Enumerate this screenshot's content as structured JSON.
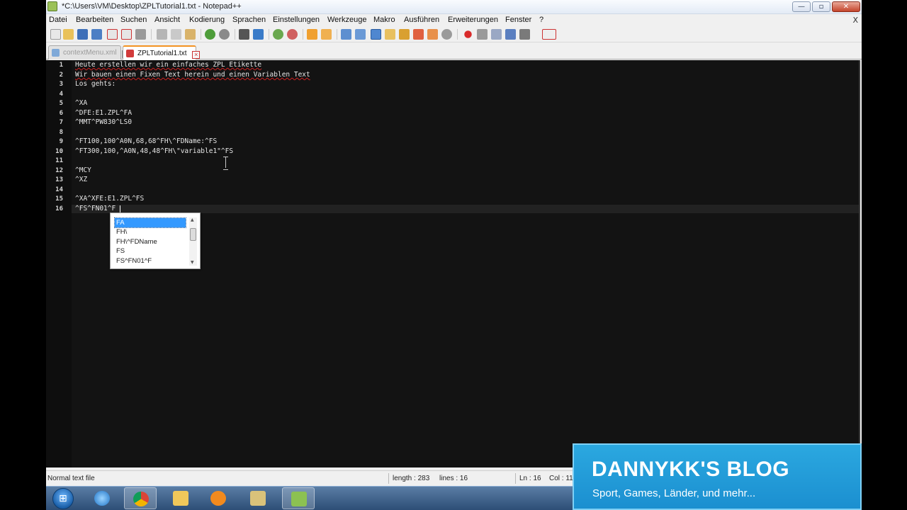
{
  "window": {
    "title": "*C:\\Users\\VM\\Desktop\\ZPLTutorial1.txt - Notepad++",
    "minimize_glyph": "—",
    "maximize_glyph": "▫",
    "close_glyph": "✕"
  },
  "menu": {
    "items": [
      "Datei",
      "Bearbeiten",
      "Suchen",
      "Ansicht",
      "Kodierung",
      "Sprachen",
      "Einstellungen",
      "Werkzeuge",
      "Makro",
      "Ausführen",
      "Erweiterungen",
      "Fenster",
      "?"
    ],
    "close_doc": "X"
  },
  "tabs": [
    {
      "label": "contextMenu.xml",
      "close": "×"
    },
    {
      "label": "ZPLTutorial1.txt",
      "close": "×"
    }
  ],
  "editor": {
    "lines": [
      "Heute erstellen wir ein einfaches ZPL Etikette",
      "Wir bauen einen Fixen Text herein und einen Variablen Text",
      "Los gehts:",
      "",
      "^XA",
      "^DFE:E1.ZPL^FA",
      "^MMT^PW830^LS0",
      "",
      "^FT100,100^A0N,68,68^FH\\^FDName:^FS",
      "^FT300,100,^A0N,48,48^FH\\\"variable1\"^FS",
      "",
      "^MCY",
      "^XZ",
      "",
      "^XA^XFE:E1.ZPL^FS",
      "^FS^FN01^F"
    ],
    "line_numbers": [
      "1",
      "2",
      "3",
      "4",
      "5",
      "6",
      "7",
      "8",
      "9",
      "10",
      "11",
      "12",
      "13",
      "14",
      "15",
      "16"
    ]
  },
  "autocomplete": {
    "items": [
      "FA",
      "FH\\",
      "FH\\^FDName",
      "FS",
      "FS^FN01^F"
    ],
    "selected_index": 0
  },
  "status": {
    "type": "Normal text file",
    "length": "length : 283",
    "lines": "lines : 16",
    "ln": "Ln : 16",
    "col": "Col : 11"
  },
  "taskbar": {
    "start_glyph": "⊞",
    "apps": [
      "internet-explorer",
      "chrome",
      "file-explorer",
      "media-player",
      "tools",
      "notepad-plus-plus"
    ],
    "active_app": "notepad-plus-plus"
  },
  "overlay": {
    "title": "DANNYKK'S BLOG",
    "subtitle": "Sport, Games, Länder, und mehr..."
  },
  "colors": {
    "editor_bg": "#131313",
    "accent_tab": "#f39322",
    "selection": "#3399ff",
    "overlay_bg": "#1b8fd0"
  }
}
